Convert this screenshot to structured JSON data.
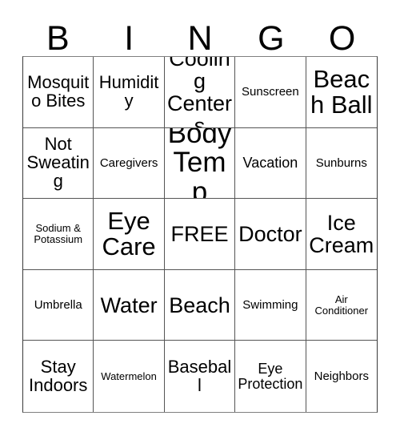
{
  "card": {
    "title": "BINGO",
    "header_letters": [
      "B",
      "I",
      "N",
      "G",
      "O"
    ],
    "free_space_label": "FREE",
    "colors": {
      "background": "#ffffff",
      "text": "#000000",
      "grid_line": "#555555"
    },
    "rows": [
      [
        {
          "label": "Mosquito Bites",
          "size": "md"
        },
        {
          "label": "Humidity",
          "size": "md"
        },
        {
          "label": "Cooling Centers",
          "size": "lg"
        },
        {
          "label": "Sunscreen",
          "size": "xs"
        },
        {
          "label": "Beach Ball",
          "size": "xl"
        }
      ],
      [
        {
          "label": "Not Sweating",
          "size": "md"
        },
        {
          "label": "Caregivers",
          "size": "xs"
        },
        {
          "label": "Body Temp",
          "size": "xxl"
        },
        {
          "label": "Vacation",
          "size": "sm"
        },
        {
          "label": "Sunburns",
          "size": "xs"
        }
      ],
      [
        {
          "label": "Sodium & Potassium",
          "size": "xxs"
        },
        {
          "label": "Eye Care",
          "size": "xl"
        },
        {
          "label": "FREE",
          "size": "lg"
        },
        {
          "label": "Doctor",
          "size": "lg"
        },
        {
          "label": "Ice Cream",
          "size": "lg"
        }
      ],
      [
        {
          "label": "Umbrella",
          "size": "xs"
        },
        {
          "label": "Water",
          "size": "lg"
        },
        {
          "label": "Beach",
          "size": "lg"
        },
        {
          "label": "Swimming",
          "size": "xs"
        },
        {
          "label": "Air Conditioner",
          "size": "xxs"
        }
      ],
      [
        {
          "label": "Stay Indoors",
          "size": "md"
        },
        {
          "label": "Watermelon",
          "size": "xxs"
        },
        {
          "label": "Baseball",
          "size": "md"
        },
        {
          "label": "Eye Protection",
          "size": "sm"
        },
        {
          "label": "Neighbors",
          "size": "xs"
        }
      ]
    ]
  }
}
